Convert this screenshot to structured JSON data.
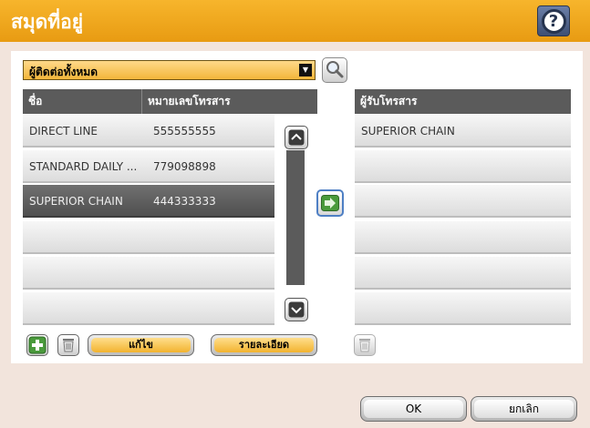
{
  "title": "สมุดที่อยู่",
  "help_icon": "question-mark-icon",
  "contact_source": "ผู้ติดต่อทั้งหมด",
  "columns": {
    "name": "ชื่อ",
    "fax": "หมายเลขโทรสาร",
    "recipients": "ผู้รับโทรสาร"
  },
  "contacts": [
    {
      "name": "DIRECT LINE",
      "fax": "555555555"
    },
    {
      "name": "STANDARD DAILY ...",
      "fax": "779098898"
    },
    {
      "name": "SUPERIOR CHAIN",
      "fax": "444333333"
    }
  ],
  "selected_contact_index": 2,
  "recipients": [
    {
      "name": "SUPERIOR CHAIN"
    }
  ],
  "buttons": {
    "edit": "แก้ไข",
    "details": "รายละเอียด",
    "ok": "OK",
    "cancel": "ยกเลิก"
  },
  "colors": {
    "title_bar": "#f0a81e",
    "selected_row": "#5d5d5d",
    "header": "#5b5b5b",
    "accent_button": "#f5bb3c"
  }
}
